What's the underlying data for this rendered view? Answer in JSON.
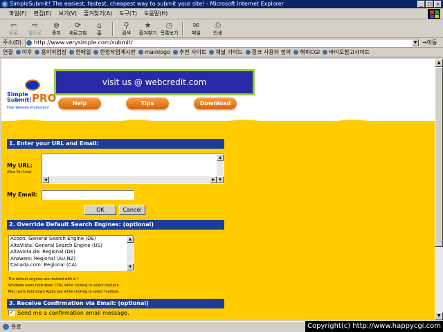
{
  "window": {
    "title": "SimpleSubmit!  The easiest, fastest, cheapest way to submit your site! - Microsoft Internet Explorer",
    "controls": [
      "_",
      "□",
      "×"
    ]
  },
  "menu": [
    "파일(F)",
    "편집(E)",
    "보기(V)",
    "즐겨찾기(A)",
    "도구(T)",
    "도움말(H)"
  ],
  "toolbar": [
    {
      "label": "뒤로",
      "icon": "back-arrow-icon",
      "glyph": "⇦",
      "dim": true
    },
    {
      "label": "앞으로",
      "icon": "forward-arrow-icon",
      "glyph": "⇨",
      "dim": true
    },
    {
      "label": "중지",
      "icon": "stop-icon",
      "glyph": "⊗",
      "dim": false
    },
    {
      "label": "새로고침",
      "icon": "refresh-icon",
      "glyph": "⟳",
      "dim": false
    },
    {
      "label": "홈",
      "icon": "home-icon",
      "glyph": "⌂",
      "dim": false
    },
    {
      "label": "검색",
      "icon": "search-icon",
      "glyph": "⚲",
      "dim": false
    },
    {
      "label": "즐겨찾기",
      "icon": "favorites-icon",
      "glyph": "★",
      "dim": false
    },
    {
      "label": "목록보기",
      "icon": "history-icon",
      "glyph": "◷",
      "dim": false
    },
    {
      "label": "메일",
      "icon": "mail-icon",
      "glyph": "✉",
      "dim": false
    },
    {
      "label": "인쇄",
      "icon": "print-icon",
      "glyph": "⎙",
      "dim": false
    }
  ],
  "address": {
    "label": "주소(D)",
    "url": "http://www.verysimple.com/submit/",
    "go_label": "→이동"
  },
  "links": {
    "label": "연결",
    "items": [
      "야후",
      "용이작업장",
      "한메일",
      "한청작업게시판",
      "mainlogo",
      "추천 사이트",
      "채널 가이드",
      "링크 사용자 정의",
      "해피CGI",
      "바이오참고사이트"
    ]
  },
  "page": {
    "logo": {
      "line1": "Simple",
      "line2": "Submit!",
      "pro": "PRO",
      "tagline": "Free Website Promotion!"
    },
    "banner": "visit us @ webcredit.com",
    "nav": [
      "Help",
      "Tips",
      "Download"
    ],
    "section1": {
      "title": "1. Enter your URL and Email:",
      "url_label": "My URL:",
      "url_sub": "(One Per Line)",
      "email_label": "My Email:",
      "ok_label": "OK",
      "cancel_label": "Cancel"
    },
    "section2": {
      "title": "2. Override Default Search Engines: (optional)",
      "engines": [
        "Acoon: General Search Engine (DE)",
        "AltaVista: General Search Engine (US)",
        "Altavista.de: Regional (DE)",
        "Anzwers: Regional (AU,NZ)",
        "Canada.com: Regional (CA)"
      ],
      "notes": [
        "The default engines are marked with a *",
        "Windows users hold down CTRL while clicking to select multiple.",
        "Mac users hold down Apple key while clicking to select multiple."
      ]
    },
    "section3": {
      "title": "3. Receive Confirmation via Email: (optional)",
      "checkbox_label": "Send me a confirmation email message.",
      "checked": true
    }
  },
  "status": {
    "text": "완료",
    "copyright": "Copyright(c) http://www.happycgi.com"
  },
  "colors": {
    "titlebar": "#0a246a",
    "page_yellow": "#ffcc00",
    "section_header": "#1c3e98",
    "banner_bg": "#2a2aa8",
    "banner_border": "#99cc33",
    "pill_orange": "#e86a00"
  }
}
